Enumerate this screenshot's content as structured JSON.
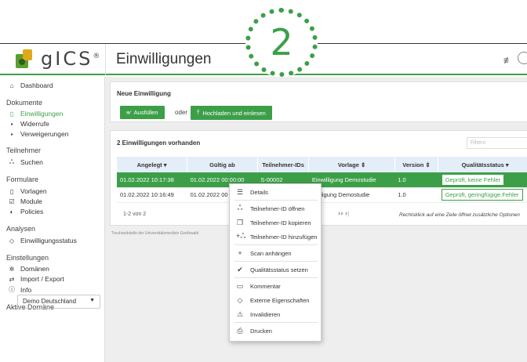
{
  "step_badge": "2",
  "app": {
    "logo_text": "gICS",
    "logo_sup": "®",
    "page_title": "Einwilligungen"
  },
  "sidebar": {
    "dashboard": "Dashboard",
    "dokumente_head": "Dokumente",
    "einwilligungen": "Einwilligungen",
    "widerrufe": "Widerrufe",
    "verweigerungen": "Verweigerungen",
    "teilnehmer_head": "Teilnehmer",
    "suchen": "Suchen",
    "formulare_head": "Formulare",
    "vorlagen": "Vorlagen",
    "module": "Module",
    "policies": "Policies",
    "analysen_head": "Analysen",
    "einwilligungsstatus": "Einwilligungsstatus",
    "einstellungen_head": "Einstellungen",
    "domaenen": "Domänen",
    "import_export": "Import / Export",
    "info": "Info",
    "aktive_domaene_head": "Aktive Domäne",
    "domain_select": "Demo Deutschland"
  },
  "new_consent": {
    "title": "Neue Einwilligung",
    "fill_button": "Ausfüllen",
    "or_text": "oder",
    "upload_button": "Hochladen und einlesen"
  },
  "list": {
    "title": "2 Einwilligungen vorhanden",
    "filter_placeholder": "Filtern",
    "columns": [
      "Angelegt ▾",
      "Gültig ab",
      "Teilnehmer-IDs",
      "Vorlage ⇕",
      "Version ⇕",
      "Qualitätsstatus ▾"
    ],
    "rows": [
      [
        "01.02.2022 10:17:38",
        "01.02.2022 00:00:00",
        "S-00002",
        "Einwilligung Demostudie",
        "1.0",
        "Geprüft, keine Fehler"
      ],
      [
        "01.02.2022 10:16:49",
        "01.02.2022 00",
        "",
        "illigung Demostudie",
        "1.0",
        "Geprüft, geringfügige Fehler"
      ]
    ],
    "pager": "1-2 von 2",
    "pager_nav": "⏵⏵ ⏵|",
    "hint": "Rechtsklick auf eine Zeile öffnet zusätzliche Optionen",
    "footer_note": "Treuhandstelle der Universitätsmedizin Greifswald"
  },
  "context_menu": {
    "items": [
      "Details",
      "Teilnehmer-ID öffnen",
      "Teilnehmer-ID kopieren",
      "Teilnehmer-ID hinzufügen",
      "Scan anhängen",
      "Qualitätsstatus setzen",
      "Kommentar",
      "Externe Eigenschaften",
      "Invalidieren",
      "Drucken"
    ]
  },
  "colors": {
    "accent": "#3c9f48",
    "header_bg": "#e4eef8"
  }
}
